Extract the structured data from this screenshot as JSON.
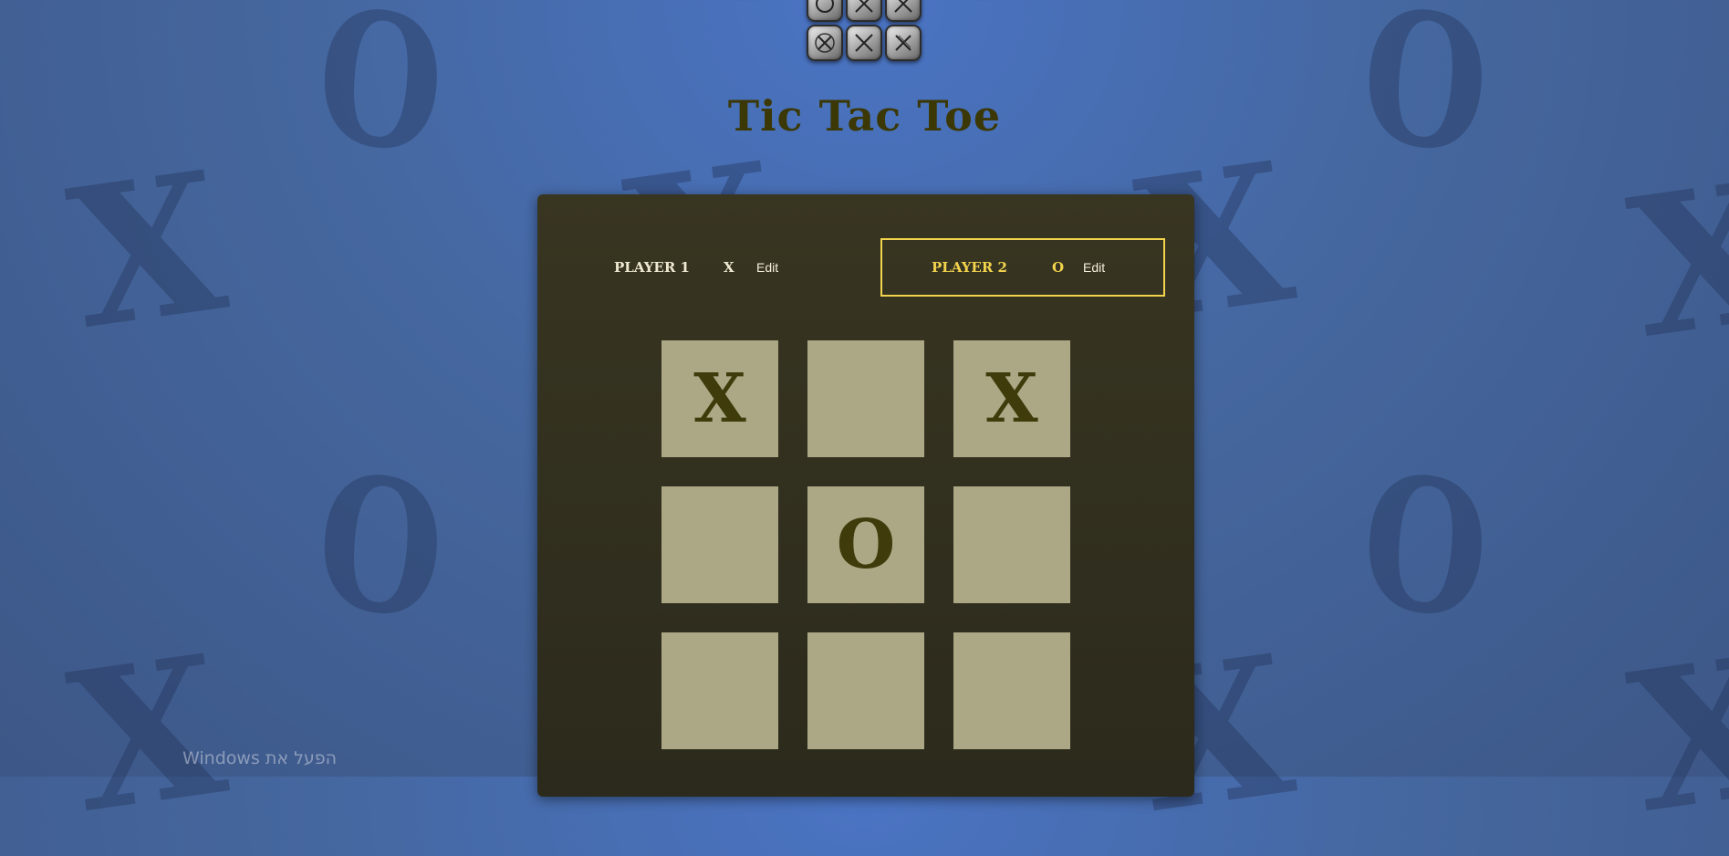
{
  "app": {
    "title": "Tic Tac Toe"
  },
  "background": {
    "glyphs": [
      "X",
      "O"
    ]
  },
  "logo": {
    "tiles_top": [
      "O",
      "X",
      "X"
    ],
    "tiles_bottom": [
      "X",
      "X",
      "X"
    ]
  },
  "players": [
    {
      "name": "PLAYER 1",
      "symbol": "X",
      "edit_label": "Edit",
      "active": false
    },
    {
      "name": "PLAYER 2",
      "symbol": "O",
      "edit_label": "Edit",
      "active": true
    }
  ],
  "board": {
    "rows": [
      [
        "X",
        "",
        "X"
      ],
      [
        "",
        "O",
        ""
      ],
      [
        "",
        "",
        ""
      ]
    ]
  },
  "colors": {
    "active_player": "#f3d44d",
    "cell": "#aca886",
    "mark": "#3f3b0b",
    "panel": "#383521",
    "background": "#4a6cb0"
  },
  "system": {
    "activation_text": "הפעל את Windows"
  }
}
